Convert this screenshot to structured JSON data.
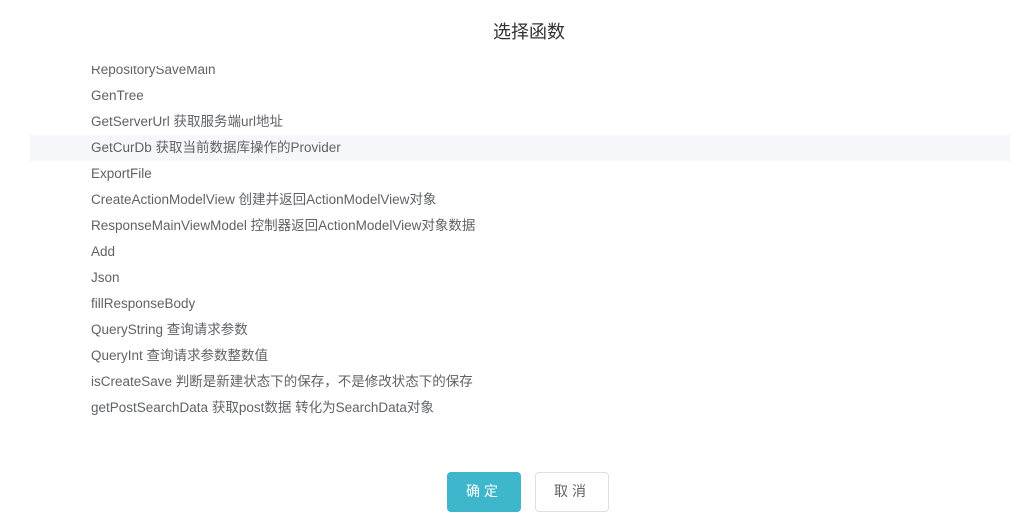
{
  "dialog": {
    "title": "选择函数"
  },
  "functions": [
    {
      "label": "RepositorySaveMain",
      "highlighted": false
    },
    {
      "label": "GenTree",
      "highlighted": false
    },
    {
      "label": "GetServerUrl 获取服务端url地址",
      "highlighted": false
    },
    {
      "label": "GetCurDb 获取当前数据库操作的Provider",
      "highlighted": true
    },
    {
      "label": "ExportFile",
      "highlighted": false
    },
    {
      "label": "CreateActionModelView 创建并返回ActionModelView对象",
      "highlighted": false
    },
    {
      "label": "ResponseMainViewModel 控制器返回ActionModelView对象数据",
      "highlighted": false
    },
    {
      "label": "Add",
      "highlighted": false
    },
    {
      "label": "Json",
      "highlighted": false
    },
    {
      "label": "fillResponseBody",
      "highlighted": false
    },
    {
      "label": "QueryString 查询请求参数",
      "highlighted": false
    },
    {
      "label": "QueryInt 查询请求参数整数值",
      "highlighted": false
    },
    {
      "label": "isCreateSave 判断是新建状态下的保存，不是修改状态下的保存",
      "highlighted": false
    },
    {
      "label": "getPostSearchData 获取post数据 转化为SearchData对象",
      "highlighted": false
    }
  ],
  "footer": {
    "confirm_label": "确定",
    "cancel_label": "取消"
  },
  "colors": {
    "accent": "#3eb6cc",
    "highlight_row": "#f5f7fa",
    "text": "#606266",
    "title": "#303133"
  }
}
